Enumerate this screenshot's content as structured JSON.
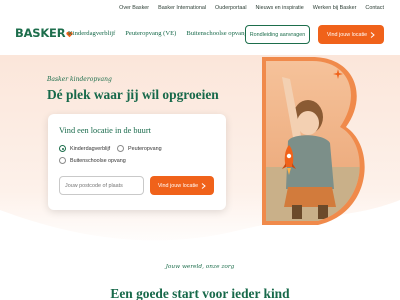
{
  "topbar": {
    "links": [
      "Over Basker",
      "Basker International",
      "Ouderportaal",
      "Nieuws en inspiratie",
      "Werken bij Basker",
      "Contact"
    ]
  },
  "header": {
    "logo_text": "BASKER",
    "nav": [
      "Kinderdagverblijf",
      "Peuteropvang (VE)",
      "Buitenschoolse opvang"
    ],
    "tour_button": "Rondleiding aanvragen",
    "find_button": "Vind jouw locatie"
  },
  "hero": {
    "eyebrow": "Basker kinderopvang",
    "title": "Dé plek waar jij wil opgroeien",
    "search_card": {
      "title": "Vind een locatie in de buurt",
      "options": [
        "Kinderdagverblijf",
        "Peuteropvang",
        "Buitenschoolse opvang"
      ],
      "selected_option": "Kinderdagverblijf",
      "postcode_placeholder": "Jouw postcode of plaats",
      "postcode_value": "",
      "submit_label": "Vind jouw locatie"
    }
  },
  "section": {
    "tagline": "Jouw wereld, onze zorg",
    "title": "Een goede start voor ieder kind"
  },
  "colors": {
    "brand_green": "#1d6e4c",
    "accent_orange": "#f0621a",
    "hero_peach": "#fbe6da",
    "frame_orange": "#f08a4b"
  },
  "icons": [
    "heart-icon",
    "chevron-right-icon",
    "rocket-icon",
    "sparkle-icon"
  ]
}
